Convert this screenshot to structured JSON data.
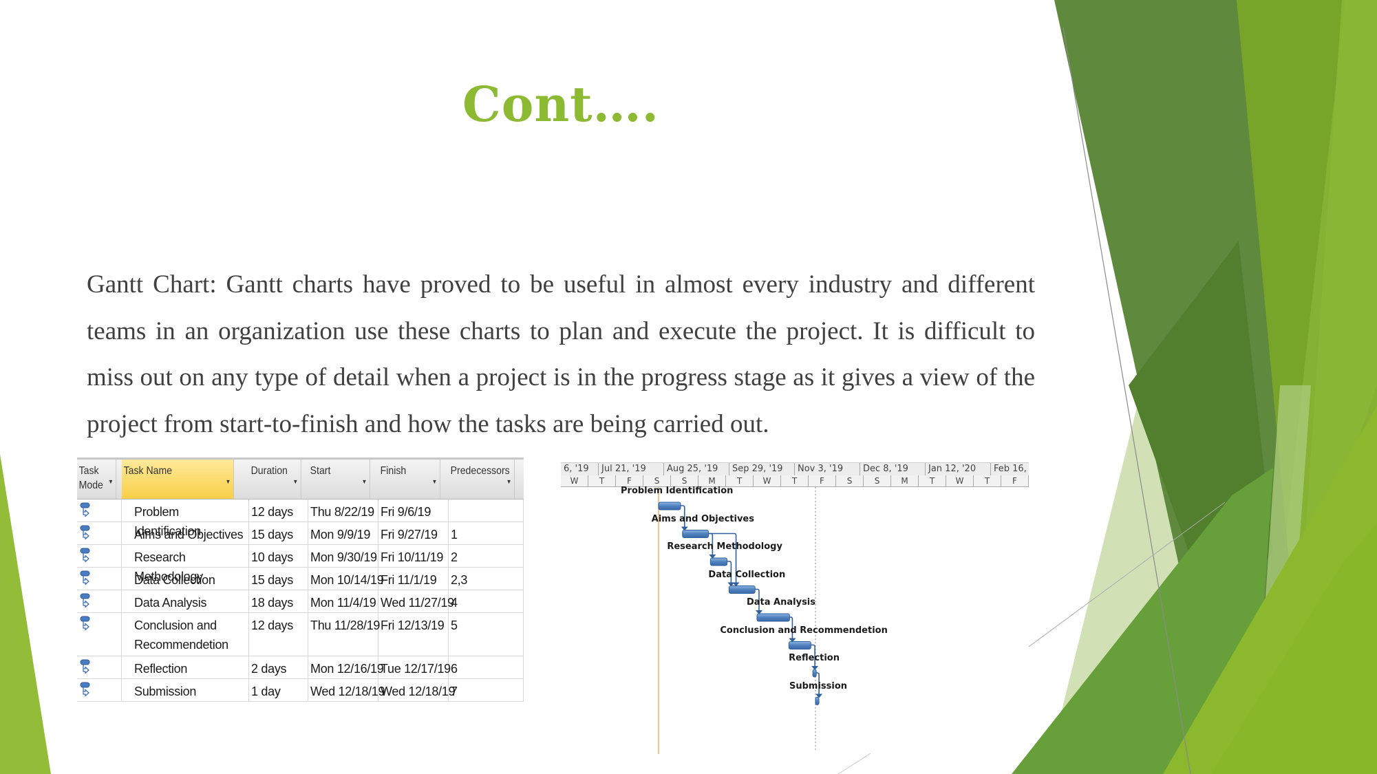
{
  "slide": {
    "title": "Cont….",
    "body": "Gantt Chart: Gantt charts have proved to be useful in almost every industry and different teams in an organization use these charts to plan and execute the project. It is difficult to miss out on any type of detail when a project is in the progress stage as it gives a view of the project from start-to-finish and how the tasks are being carried out.",
    "colors": {
      "title": "#8cba32",
      "body_text": "#404040",
      "bar": "#4f81bd",
      "link": "#2f5f9e"
    }
  },
  "task_table": {
    "headers": [
      "Task Mode",
      "Task Name",
      "Duration",
      "Start",
      "Finish",
      "Predecessors"
    ],
    "header_icons": [
      "dropdown-arrow-icon"
    ],
    "rows": [
      {
        "mode": "auto-scheduled-icon",
        "name": "Problem Identification",
        "duration": "12 days",
        "start": "Thu 8/22/19",
        "finish": "Fri 9/6/19",
        "predecessors": ""
      },
      {
        "mode": "auto-scheduled-icon",
        "name": "Aims and Objectives",
        "duration": "15 days",
        "start": "Mon 9/9/19",
        "finish": "Fri 9/27/19",
        "predecessors": "1"
      },
      {
        "mode": "auto-scheduled-icon",
        "name": "Research Methodology",
        "duration": "10 days",
        "start": "Mon 9/30/19",
        "finish": "Fri 10/11/19",
        "predecessors": "2"
      },
      {
        "mode": "auto-scheduled-icon",
        "name": "Data Collection",
        "duration": "15 days",
        "start": "Mon 10/14/19",
        "finish": "Fri 11/1/19",
        "predecessors": "2,3"
      },
      {
        "mode": "auto-scheduled-icon",
        "name": "Data Analysis",
        "duration": "18 days",
        "start": "Mon 11/4/19",
        "finish": "Wed 11/27/19",
        "predecessors": "4"
      },
      {
        "mode": "auto-scheduled-icon",
        "name": "Conclusion and Recommendetion",
        "duration": "12 days",
        "start": "Thu 11/28/19",
        "finish": "Fri 12/13/19",
        "predecessors": "5"
      },
      {
        "mode": "auto-scheduled-icon",
        "name": "Reflection",
        "duration": "2 days",
        "start": "Mon 12/16/19",
        "finish": "Tue 12/17/19",
        "predecessors": "6"
      },
      {
        "mode": "auto-scheduled-icon",
        "name": "Submission",
        "duration": "1 day",
        "start": "Wed 12/18/19",
        "finish": "Wed 12/18/19",
        "predecessors": "7"
      }
    ]
  },
  "gantt": {
    "timescale_major": [
      "6, '19",
      "Jul 21, '19",
      "Aug 25, '19",
      "Sep 29, '19",
      "Nov 3, '19",
      "Dec 8, '19",
      "Jan 12, '20",
      "Feb 16, '"
    ],
    "timescale_minor": [
      "W",
      "T",
      "F",
      "S",
      "S",
      "M",
      "T",
      "W",
      "T",
      "F",
      "S",
      "S",
      "M",
      "T",
      "W",
      "T",
      "F"
    ],
    "bar_labels": [
      "Problem Identification",
      "Aims and Objectives",
      "Research Methodology",
      "Data Collection",
      "Data Analysis",
      "Conclusion and Recommendetion",
      "Reflection",
      "Submission"
    ]
  },
  "chart_data": {
    "type": "gantt",
    "title": "",
    "tasks": [
      {
        "id": 1,
        "name": "Problem Identification",
        "start": "2019-08-22",
        "finish": "2019-09-06",
        "duration_days": 12,
        "predecessors": []
      },
      {
        "id": 2,
        "name": "Aims and Objectives",
        "start": "2019-09-09",
        "finish": "2019-09-27",
        "duration_days": 15,
        "predecessors": [
          1
        ]
      },
      {
        "id": 3,
        "name": "Research Methodology",
        "start": "2019-09-30",
        "finish": "2019-10-11",
        "duration_days": 10,
        "predecessors": [
          2
        ]
      },
      {
        "id": 4,
        "name": "Data Collection",
        "start": "2019-10-14",
        "finish": "2019-11-01",
        "duration_days": 15,
        "predecessors": [
          2,
          3
        ]
      },
      {
        "id": 5,
        "name": "Data Analysis",
        "start": "2019-11-04",
        "finish": "2019-11-27",
        "duration_days": 18,
        "predecessors": [
          4
        ]
      },
      {
        "id": 6,
        "name": "Conclusion and Recommendetion",
        "start": "2019-11-28",
        "finish": "2019-12-13",
        "duration_days": 12,
        "predecessors": [
          5
        ]
      },
      {
        "id": 7,
        "name": "Reflection",
        "start": "2019-12-16",
        "finish": "2019-12-17",
        "duration_days": 2,
        "predecessors": [
          6
        ]
      },
      {
        "id": 8,
        "name": "Submission",
        "start": "2019-12-18",
        "finish": "2019-12-18",
        "duration_days": 1,
        "predecessors": [
          7
        ]
      }
    ],
    "x_range": [
      "2019-06-16",
      "2020-02-20"
    ],
    "xtick_labels": [
      "6, '19",
      "Jul 21, '19",
      "Aug 25, '19",
      "Sep 29, '19",
      "Nov 3, '19",
      "Dec 8, '19",
      "Jan 12, '20",
      "Feb 16, '"
    ],
    "markers": {
      "project_start": "2019-08-22",
      "status_date": "2019-12-18"
    }
  }
}
